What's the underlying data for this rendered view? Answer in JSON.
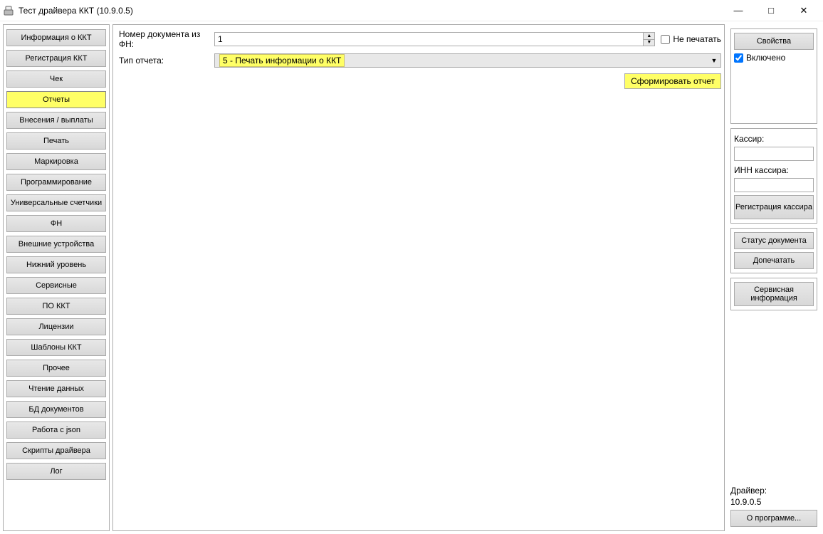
{
  "window": {
    "title": "Тест драйвера ККТ (10.9.0.5)"
  },
  "sidebar": {
    "items": [
      {
        "label": "Информация о ККТ",
        "active": false
      },
      {
        "label": "Регистрация ККТ",
        "active": false
      },
      {
        "label": "Чек",
        "active": false
      },
      {
        "label": "Отчеты",
        "active": true
      },
      {
        "label": "Внесения / выплаты",
        "active": false
      },
      {
        "label": "Печать",
        "active": false
      },
      {
        "label": "Маркировка",
        "active": false
      },
      {
        "label": "Программирование",
        "active": false
      },
      {
        "label": "Универсальные счетчики",
        "active": false
      },
      {
        "label": "ФН",
        "active": false
      },
      {
        "label": "Внешние устройства",
        "active": false
      },
      {
        "label": "Нижний уровень",
        "active": false
      },
      {
        "label": "Сервисные",
        "active": false
      },
      {
        "label": "ПО ККТ",
        "active": false
      },
      {
        "label": "Лицензии",
        "active": false
      },
      {
        "label": "Шаблоны ККТ",
        "active": false
      },
      {
        "label": "Прочее",
        "active": false
      },
      {
        "label": "Чтение данных",
        "active": false
      },
      {
        "label": "БД документов",
        "active": false
      },
      {
        "label": "Работа с json",
        "active": false
      },
      {
        "label": "Скрипты драйвера",
        "active": false
      },
      {
        "label": "Лог",
        "active": false
      }
    ]
  },
  "report": {
    "doc_number_label": "Номер документа из ФН:",
    "doc_number_value": "1",
    "no_print_label": "Не печатать",
    "no_print_checked": false,
    "type_label": "Тип отчета:",
    "type_value": "5 - Печать информации о ККТ",
    "generate_button": "Сформировать отчет"
  },
  "right": {
    "properties_button": "Свойства",
    "enabled_label": "Включено",
    "enabled_checked": true,
    "cashier_label": "Кассир:",
    "cashier_value": "",
    "cashier_inn_label": "ИНН кассира:",
    "cashier_inn_value": "",
    "cashier_register_button": "Регистрация кассира",
    "doc_status_button": "Статус документа",
    "print_more_button": "Допечатать",
    "service_info_button": "Сервисная информация",
    "driver_label": "Драйвер:",
    "driver_version": "10.9.0.5",
    "about_button": "О программе..."
  }
}
